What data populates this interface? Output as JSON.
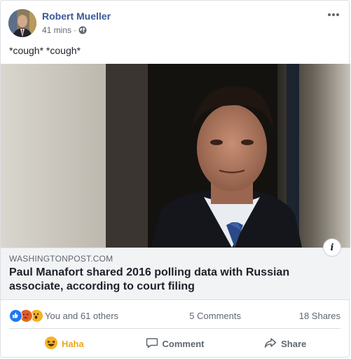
{
  "post": {
    "author": "Robert Mueller",
    "time": "41 mins",
    "meta_separator": "·",
    "text": "*cough* *cough*"
  },
  "link": {
    "domain": "WASHINGTONPOST.COM",
    "headline": "Paul Manafort shared 2016 polling data with Russian associate, according to court filing",
    "info_label": "i"
  },
  "stats": {
    "reactors": "You and 61 others",
    "comments": "5 Comments",
    "shares": "18 Shares",
    "reaction_icons": [
      "like-icon",
      "angry-icon",
      "wow-icon"
    ]
  },
  "actions": {
    "react_label": "Haha",
    "comment_label": "Comment",
    "share_label": "Share"
  },
  "colors": {
    "author_link": "#385898",
    "haha": "#e9a81a",
    "like": "#2078f4",
    "angry": "#e9710f",
    "wow": "#f7b125"
  }
}
